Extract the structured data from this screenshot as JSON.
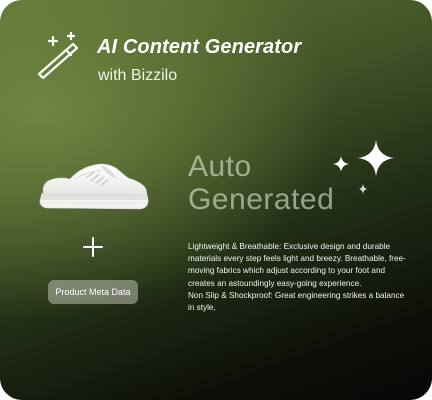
{
  "header": {
    "title": "AI Content Generator",
    "subtitle": "with Bizzilo"
  },
  "icons": {
    "wand": "magic-wand-icon",
    "shoe": "sneaker-image",
    "plus": "plus-icon",
    "sparkles": "sparkles-icon"
  },
  "input": {
    "button_label": "Product Meta Data"
  },
  "output": {
    "heading_line1": "Auto",
    "heading_line2": "Generated",
    "description": [
      "Lightweight & Breathable: Exclusive design and durable materials every step feels light and breezy. Breathable, free-moving fabrics which adjust according to your foot and creates an astoundingly easy-going experience.",
      "Non Slip & Shockproof: Great engineering strikes a balance in style,"
    ]
  },
  "colors": {
    "gradient_top": "#5f7635",
    "gradient_bottom": "#070806",
    "text_primary": "#ffffff",
    "heading_muted": "#dee2d4"
  }
}
